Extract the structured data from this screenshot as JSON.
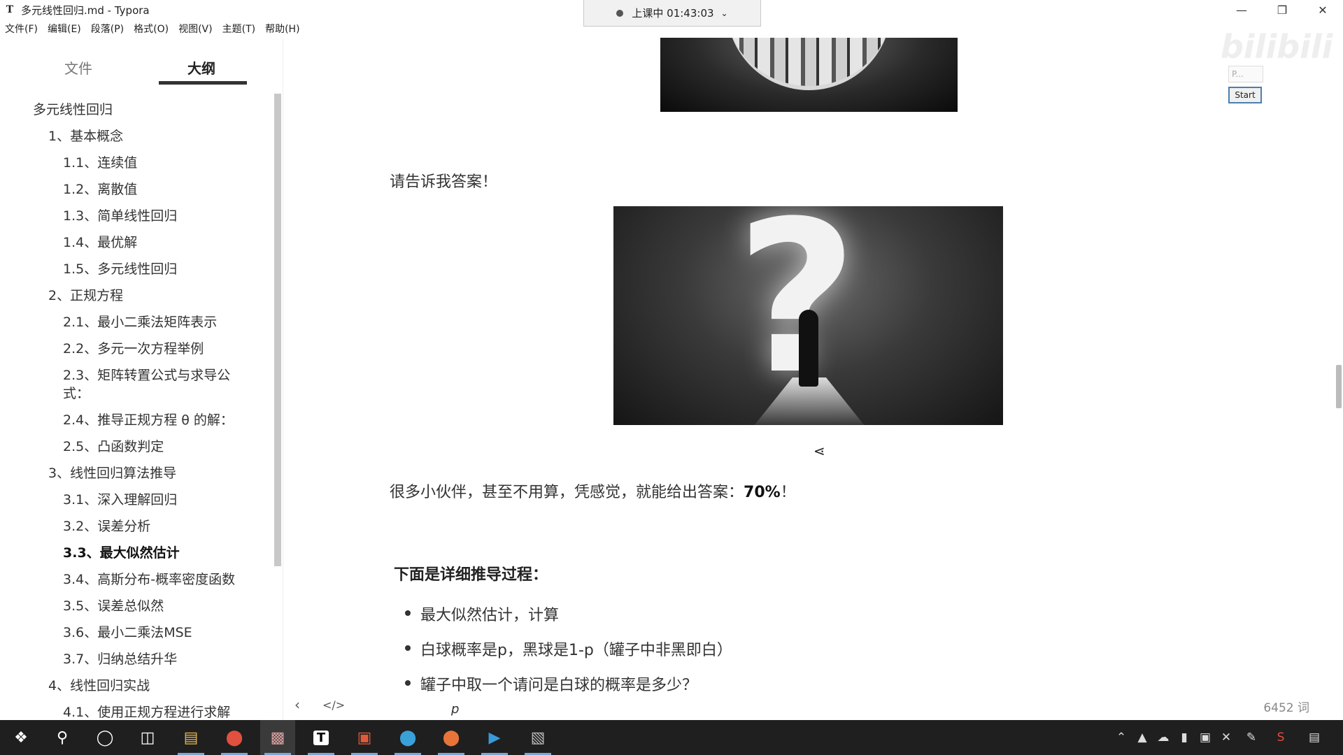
{
  "window": {
    "title": "多元线性回归.md - Typora",
    "app_icon": "T"
  },
  "menu": [
    "文件(F)",
    "编辑(E)",
    "段落(P)",
    "格式(O)",
    "视图(V)",
    "主题(T)",
    "帮助(H)"
  ],
  "timer": {
    "label": "上课中 01:43:03"
  },
  "sidebar": {
    "tabs": {
      "files": "文件",
      "outline": "大纲"
    },
    "outline": [
      {
        "label": "多元线性回归"
      },
      {
        "label": "1、基本概念"
      },
      {
        "label": "1.1、连续值"
      },
      {
        "label": "1.2、离散值"
      },
      {
        "label": "1.3、简单线性回归"
      },
      {
        "label": "1.4、最优解"
      },
      {
        "label": "1.5、多元线性回归"
      },
      {
        "label": "2、正规方程"
      },
      {
        "label": "2.1、最小二乘法矩阵表示"
      },
      {
        "label": "2.2、多元一次方程举例"
      },
      {
        "label": "2.3、矩阵转置公式与求导公"
      },
      {
        "label": "式："
      },
      {
        "label": "2.4、推导正规方程 θ 的解："
      },
      {
        "label": "2.5、凸函数判定"
      },
      {
        "label": "3、线性回归算法推导"
      },
      {
        "label": "3.1、深入理解回归"
      },
      {
        "label": "3.2、误差分析"
      },
      {
        "label": "3.3、最大似然估计"
      },
      {
        "label": "3.4、高斯分布-概率密度函数"
      },
      {
        "label": "3.5、误差总似然"
      },
      {
        "label": "3.6、最小二乘法MSE"
      },
      {
        "label": "3.7、归纳总结升华"
      },
      {
        "label": "4、线性回归实战"
      },
      {
        "label": "4.1、使用正规方程进行求解"
      }
    ]
  },
  "document": {
    "ask": "请告诉我答案！",
    "answer_prefix": "很多小伙伴，甚至不用算，凭感觉，就能给出答案：",
    "answer_bold": "70%",
    "answer_suffix": "！",
    "heading": "下面是详细推导过程：",
    "bullets": [
      "最大似然估计，计算",
      "白球概率是p，黑球是1-p（罐子中非黑即白）",
      "罐子中取一个请问是白球的概率是多少？"
    ],
    "partial_line": "p"
  },
  "status": {
    "word_count": "6452 词"
  },
  "overlay": {
    "field": "P...",
    "start": "Start",
    "watermark": "bilibili"
  },
  "taskbar": {
    "icons": [
      "windows-start-icon",
      "search-icon",
      "cortana-icon",
      "task-view-icon",
      "file-explorer-icon",
      "chrome-icon",
      "paint-icon",
      "typora-icon",
      "presenter-icon",
      "edge-icon",
      "firefox-icon",
      "app-icon",
      "terminal-icon"
    ]
  }
}
